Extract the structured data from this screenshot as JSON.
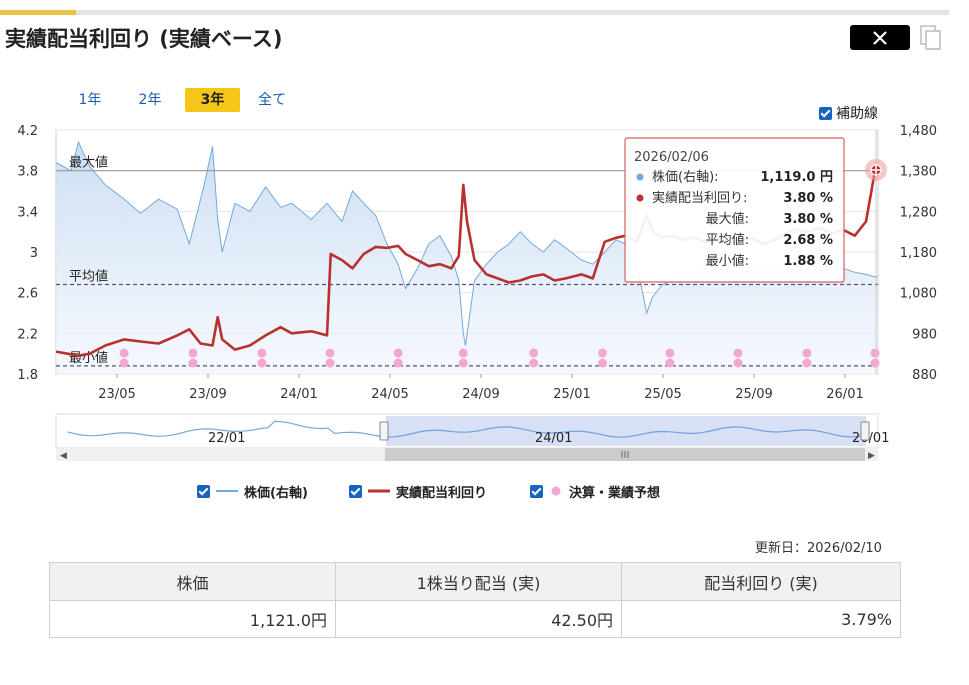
{
  "header": {
    "title": "実績配当利回り (実績ベース)"
  },
  "toolbar": {
    "share_icon": "x-icon",
    "copy_icon": "copy-icon"
  },
  "ranges": [
    {
      "label": "1年"
    },
    {
      "label": "2年"
    },
    {
      "label": "3年",
      "active": true
    },
    {
      "label": "全て"
    }
  ],
  "aux_lines": {
    "label": "補助線",
    "checked": true
  },
  "legend": [
    {
      "label": "株価(右軸)",
      "color": "#74a9dc",
      "checked": true
    },
    {
      "label": "実績配当利回り",
      "color": "#b8312f",
      "checked": true
    },
    {
      "label": "決算・業績予想",
      "color": "#f5a6d0",
      "checked": true
    }
  ],
  "tooltip": {
    "date": "2026/02/06",
    "rows": [
      {
        "label": "株価(右軸):",
        "value": "1,119.0 円",
        "dot": "#74a9dc"
      },
      {
        "label": "実績配当利回り:",
        "value": "3.80 %",
        "dot": "#b8312f"
      },
      {
        "label": "最大値:",
        "value": "3.80 %"
      },
      {
        "label": "平均値:",
        "value": "2.68 %"
      },
      {
        "label": "最小値:",
        "value": "1.88 %"
      }
    ]
  },
  "navigator": {
    "labels": [
      "22/01",
      "24/01",
      "26/01"
    ]
  },
  "updated": "更新日：2026/02/10",
  "summary": {
    "headers": [
      "株価",
      "1株当り配当 (実)",
      "配当利回り (実)"
    ],
    "values": [
      "1,121.0円",
      "42.50円",
      "3.79%"
    ]
  },
  "chart_data": {
    "type": "line",
    "x_ticks": [
      "23/05",
      "23/09",
      "24/01",
      "24/05",
      "24/09",
      "25/01",
      "25/05",
      "25/09",
      "26/01"
    ],
    "y_left": {
      "min": 1.8,
      "max": 4.2,
      "ticks": [
        "4.2",
        "3.8",
        "3.4",
        "3",
        "2.6",
        "2.2",
        "1.8"
      ]
    },
    "y_right": {
      "min": 880,
      "max": 1480,
      "ticks": [
        "1,480",
        "1,380",
        "1,280",
        "1,180",
        "1,080",
        "980",
        "880"
      ]
    },
    "reference_lines": [
      {
        "label": "最大値",
        "value": 3.8
      },
      {
        "label": "平均値",
        "value": 2.68
      },
      {
        "label": "最小値",
        "value": 1.88
      }
    ],
    "x_domain": [
      "2023-02-08",
      "2026-02-10"
    ],
    "series": [
      {
        "name": "株価(右軸)",
        "axis": "right",
        "color": "#74a9dc",
        "points": [
          [
            "2023-02-08",
            1400
          ],
          [
            "2023-02-28",
            1380
          ],
          [
            "2023-03-10",
            1450
          ],
          [
            "2023-03-25",
            1390
          ],
          [
            "2023-04-15",
            1345
          ],
          [
            "2023-05-10",
            1310
          ],
          [
            "2023-06-01",
            1275
          ],
          [
            "2023-06-25",
            1310
          ],
          [
            "2023-07-20",
            1285
          ],
          [
            "2023-08-05",
            1200
          ],
          [
            "2023-08-25",
            1345
          ],
          [
            "2023-09-05",
            1440
          ],
          [
            "2023-09-12",
            1260
          ],
          [
            "2023-09-18",
            1180
          ],
          [
            "2023-10-05",
            1300
          ],
          [
            "2023-10-25",
            1280
          ],
          [
            "2023-11-15",
            1340
          ],
          [
            "2023-12-05",
            1290
          ],
          [
            "2023-12-20",
            1300
          ],
          [
            "2024-01-15",
            1260
          ],
          [
            "2024-02-05",
            1300
          ],
          [
            "2024-02-25",
            1255
          ],
          [
            "2024-03-10",
            1330
          ],
          [
            "2024-03-25",
            1300
          ],
          [
            "2024-04-10",
            1270
          ],
          [
            "2024-04-25",
            1200
          ],
          [
            "2024-05-10",
            1150
          ],
          [
            "2024-05-20",
            1090
          ],
          [
            "2024-06-05",
            1140
          ],
          [
            "2024-06-20",
            1200
          ],
          [
            "2024-07-05",
            1220
          ],
          [
            "2024-07-20",
            1170
          ],
          [
            "2024-07-30",
            1110
          ],
          [
            "2024-08-05",
            980
          ],
          [
            "2024-08-08",
            950
          ],
          [
            "2024-08-20",
            1110
          ],
          [
            "2024-09-05",
            1150
          ],
          [
            "2024-09-20",
            1180
          ],
          [
            "2024-10-05",
            1200
          ],
          [
            "2024-10-20",
            1230
          ],
          [
            "2024-11-05",
            1200
          ],
          [
            "2024-11-20",
            1180
          ],
          [
            "2024-12-05",
            1210
          ],
          [
            "2024-12-20",
            1190
          ],
          [
            "2025-01-10",
            1160
          ],
          [
            "2025-01-25",
            1150
          ],
          [
            "2025-02-10",
            1180
          ],
          [
            "2025-02-25",
            1210
          ],
          [
            "2025-03-10",
            1200
          ],
          [
            "2025-03-25",
            1150
          ],
          [
            "2025-04-07",
            1030
          ],
          [
            "2025-04-15",
            1070
          ],
          [
            "2025-04-28",
            1100
          ],
          [
            "2025-05-10",
            1110
          ],
          [
            "2025-05-25",
            1130
          ],
          [
            "2025-06-10",
            1120
          ],
          [
            "2025-06-25",
            1140
          ],
          [
            "2025-07-10",
            1130
          ],
          [
            "2025-07-25",
            1150
          ],
          [
            "2025-08-10",
            1140
          ],
          [
            "2025-08-25",
            1130
          ],
          [
            "2025-09-10",
            1150
          ],
          [
            "2025-09-25",
            1140
          ],
          [
            "2025-10-10",
            1150
          ],
          [
            "2025-10-25",
            1130
          ],
          [
            "2025-11-10",
            1140
          ],
          [
            "2025-11-25",
            1130
          ],
          [
            "2025-12-10",
            1150
          ],
          [
            "2025-12-25",
            1140
          ],
          [
            "2026-01-10",
            1130
          ],
          [
            "2026-01-25",
            1125
          ],
          [
            "2026-02-06",
            1119
          ],
          [
            "2026-02-10",
            1121
          ]
        ]
      },
      {
        "name": "実績配当利回り",
        "axis": "left",
        "color": "#b8312f",
        "points": [
          [
            "2023-02-08",
            2.02
          ],
          [
            "2023-03-10",
            1.98
          ],
          [
            "2023-03-25",
            2.0
          ],
          [
            "2023-04-15",
            2.08
          ],
          [
            "2023-05-10",
            2.14
          ],
          [
            "2023-06-01",
            2.12
          ],
          [
            "2023-06-25",
            2.1
          ],
          [
            "2023-07-20",
            2.18
          ],
          [
            "2023-08-05",
            2.24
          ],
          [
            "2023-08-20",
            2.1
          ],
          [
            "2023-09-05",
            2.08
          ],
          [
            "2023-09-12",
            2.36
          ],
          [
            "2023-09-18",
            2.14
          ],
          [
            "2023-10-05",
            2.04
          ],
          [
            "2023-10-25",
            2.08
          ],
          [
            "2023-11-15",
            2.18
          ],
          [
            "2023-12-05",
            2.26
          ],
          [
            "2023-12-20",
            2.2
          ],
          [
            "2024-01-15",
            2.22
          ],
          [
            "2024-02-05",
            2.18
          ],
          [
            "2024-02-10",
            2.98
          ],
          [
            "2024-02-25",
            2.92
          ],
          [
            "2024-03-10",
            2.84
          ],
          [
            "2024-03-25",
            2.98
          ],
          [
            "2024-04-10",
            3.05
          ],
          [
            "2024-04-25",
            3.04
          ],
          [
            "2024-05-10",
            3.06
          ],
          [
            "2024-05-20",
            2.98
          ],
          [
            "2024-06-05",
            2.92
          ],
          [
            "2024-06-20",
            2.86
          ],
          [
            "2024-07-05",
            2.88
          ],
          [
            "2024-07-20",
            2.84
          ],
          [
            "2024-07-30",
            2.96
          ],
          [
            "2024-08-05",
            3.66
          ],
          [
            "2024-08-10",
            3.3
          ],
          [
            "2024-08-20",
            2.92
          ],
          [
            "2024-09-05",
            2.78
          ],
          [
            "2024-09-20",
            2.74
          ],
          [
            "2024-10-05",
            2.7
          ],
          [
            "2024-10-20",
            2.72
          ],
          [
            "2024-11-05",
            2.76
          ],
          [
            "2024-11-20",
            2.78
          ],
          [
            "2024-12-05",
            2.72
          ],
          [
            "2024-12-20",
            2.74
          ],
          [
            "2025-01-10",
            2.78
          ],
          [
            "2025-01-25",
            2.74
          ],
          [
            "2025-02-10",
            3.1
          ],
          [
            "2025-02-25",
            3.14
          ],
          [
            "2025-03-10",
            3.16
          ],
          [
            "2025-03-25",
            3.1
          ],
          [
            "2025-04-07",
            3.36
          ],
          [
            "2025-04-15",
            3.2
          ],
          [
            "2025-04-28",
            3.14
          ],
          [
            "2025-05-10",
            3.16
          ],
          [
            "2025-05-25",
            3.12
          ],
          [
            "2025-06-10",
            3.14
          ],
          [
            "2025-06-25",
            3.1
          ],
          [
            "2025-07-10",
            3.12
          ],
          [
            "2025-07-25",
            3.08
          ],
          [
            "2025-08-10",
            3.12
          ],
          [
            "2025-08-25",
            3.14
          ],
          [
            "2025-09-10",
            3.08
          ],
          [
            "2025-09-25",
            3.12
          ],
          [
            "2025-10-10",
            3.18
          ],
          [
            "2025-10-25",
            3.22
          ],
          [
            "2025-11-10",
            3.2
          ],
          [
            "2025-11-25",
            3.24
          ],
          [
            "2025-12-10",
            3.18
          ],
          [
            "2025-12-25",
            3.22
          ],
          [
            "2026-01-10",
            3.16
          ],
          [
            "2026-01-25",
            3.3
          ],
          [
            "2026-02-06",
            3.8
          ],
          [
            "2026-02-10",
            3.79
          ]
        ]
      }
    ],
    "events": [
      "2023-05-10",
      "2023-08-10",
      "2023-11-10",
      "2024-02-09",
      "2024-05-10",
      "2024-08-05",
      "2024-11-07",
      "2025-02-07",
      "2025-05-08",
      "2025-08-07",
      "2025-11-07",
      "2026-02-06"
    ]
  }
}
